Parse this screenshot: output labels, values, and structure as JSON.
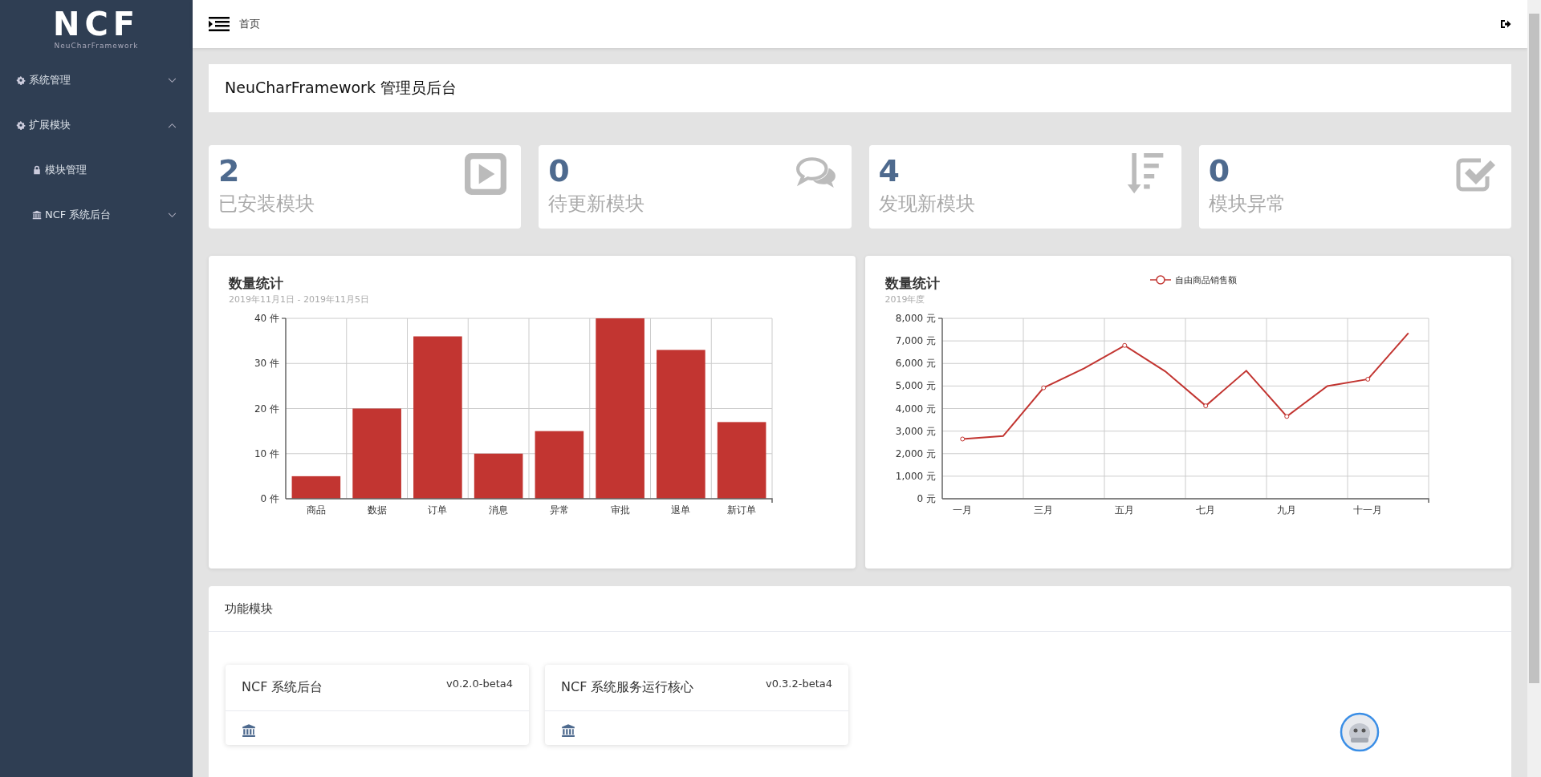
{
  "sidebar": {
    "logo": "NCF",
    "logo_subtitle": "NeuCharFramework",
    "items": [
      {
        "label": "系统管理",
        "expanded": false
      },
      {
        "label": "扩展模块",
        "expanded": true,
        "children": [
          {
            "label": "模块管理"
          },
          {
            "label": "NCF 系统后台",
            "expanded": false
          }
        ]
      }
    ]
  },
  "header": {
    "breadcrumb": "首页"
  },
  "page_title": "NeuCharFramework 管理员后台",
  "stats": [
    {
      "count": "2",
      "label": "已安装模块"
    },
    {
      "count": "0",
      "label": "待更新模块"
    },
    {
      "count": "4",
      "label": "发现新模块"
    },
    {
      "count": "0",
      "label": "模块异常"
    }
  ],
  "charts": [
    {
      "title": "数量统计",
      "subtitle": "2019年11月1日 - 2019年11月5日",
      "chart_data": {
        "type": "bar",
        "categories": [
          "商品",
          "数据",
          "订单",
          "消息",
          "异常",
          "审批",
          "退单",
          "新订单"
        ],
        "series": [
          {
            "color": "#c23531",
            "values": [
              5,
              20,
              36,
              10,
              15,
              40,
              33,
              17
            ]
          }
        ],
        "grid": true,
        "ylim": [
          0,
          40
        ],
        "yticks": [
          {
            "value": 0,
            "label": "0 件"
          },
          {
            "value": 10,
            "label": "10 件"
          },
          {
            "value": 20,
            "label": "20 件"
          },
          {
            "value": 30,
            "label": "30 件"
          },
          {
            "value": 40,
            "label": "40 件"
          }
        ]
      }
    },
    {
      "title": "数量统计",
      "subtitle": "2019年度",
      "chart_data": {
        "type": "line",
        "grid": true,
        "categories": [
          "一月",
          null,
          "三月",
          null,
          "五月",
          null,
          "七月",
          null,
          "九月",
          null,
          "十一月",
          null
        ],
        "series": [
          {
            "name": "自由商品销售额",
            "color": "#c23531",
            "values": [
              2650,
              2780,
              4920,
              5780,
              6800,
              5650,
              4120,
              5680,
              3650,
              5000,
              5300,
              7350
            ]
          }
        ],
        "ylim": [
          0,
          8000
        ],
        "yticks": [
          {
            "value": 0,
            "label": "0 元"
          },
          {
            "value": 1000,
            "label": "1,000 元"
          },
          {
            "value": 2000,
            "label": "2,000 元"
          },
          {
            "value": 3000,
            "label": "3,000 元"
          },
          {
            "value": 4000,
            "label": "4,000 元"
          },
          {
            "value": 5000,
            "label": "5,000 元"
          },
          {
            "value": 6000,
            "label": "6,000 元"
          },
          {
            "value": 7000,
            "label": "7,000 元"
          },
          {
            "value": 8000,
            "label": "8,000 元"
          }
        ]
      }
    }
  ],
  "modules": {
    "title": "功能模块",
    "items": [
      {
        "name": "NCF 系统后台",
        "version": "v0.2.0-beta4"
      },
      {
        "name": "NCF 系统服务运行核心",
        "version": "v0.3.2-beta4"
      }
    ]
  }
}
